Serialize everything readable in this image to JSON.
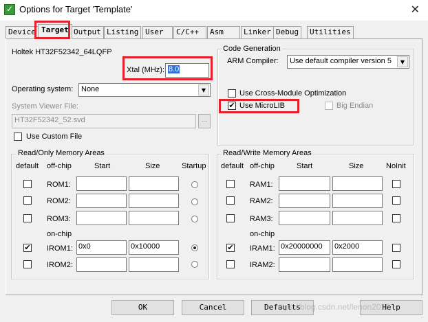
{
  "window": {
    "title": "Options for Target 'Template'",
    "close_glyph": "✕"
  },
  "tabs": [
    {
      "label": "Device",
      "active": false
    },
    {
      "label": "Target",
      "active": true
    },
    {
      "label": "Output",
      "active": false
    },
    {
      "label": "Listing",
      "active": false
    },
    {
      "label": "User",
      "active": false
    },
    {
      "label": "C/C++",
      "active": false
    },
    {
      "label": "Asm",
      "active": false
    },
    {
      "label": "Linker",
      "active": false
    },
    {
      "label": "Debug",
      "active": false
    },
    {
      "label": "Utilities",
      "active": false
    }
  ],
  "target": {
    "device_name": "Holtek HT32F52342_64LQFP",
    "xtal_label": "Xtal (MHz):",
    "xtal_value": "8.0",
    "os_label": "Operating system:",
    "os_value": "None",
    "svf_label": "System Viewer File:",
    "svf_value": "HT32F52342_52.svd",
    "svf_browse": "...",
    "custom_file_label": "Use Custom File"
  },
  "code_gen": {
    "title": "Code Generation",
    "compiler_label": "ARM Compiler:",
    "compiler_value": "Use default compiler version 5",
    "cross_module_label": "Use Cross-Module Optimization",
    "cross_module_checked": false,
    "microlib_label": "Use MicroLIB",
    "microlib_checked": true,
    "big_endian_label": "Big Endian",
    "big_endian_checked": false
  },
  "rom_areas": {
    "title": "Read/Only Memory Areas",
    "headers": {
      "default": "default",
      "offchip": "off-chip",
      "start": "Start",
      "size": "Size",
      "startup": "Startup"
    },
    "onchip_label": "on-chip",
    "rows": [
      {
        "name": "ROM1:",
        "start": "",
        "size": "",
        "default": false,
        "startup": false
      },
      {
        "name": "ROM2:",
        "start": "",
        "size": "",
        "default": false,
        "startup": false
      },
      {
        "name": "ROM3:",
        "start": "",
        "size": "",
        "default": false,
        "startup": false
      },
      {
        "name": "IROM1:",
        "start": "0x0",
        "size": "0x10000",
        "default": true,
        "startup": true
      },
      {
        "name": "IROM2:",
        "start": "",
        "size": "",
        "default": false,
        "startup": false
      }
    ]
  },
  "ram_areas": {
    "title": "Read/Write Memory Areas",
    "headers": {
      "default": "default",
      "offchip": "off-chip",
      "start": "Start",
      "size": "Size",
      "noinit": "NoInit"
    },
    "onchip_label": "on-chip",
    "rows": [
      {
        "name": "RAM1:",
        "start": "",
        "size": "",
        "default": false,
        "noinit": false
      },
      {
        "name": "RAM2:",
        "start": "",
        "size": "",
        "default": false,
        "noinit": false
      },
      {
        "name": "RAM3:",
        "start": "",
        "size": "",
        "default": false,
        "noinit": false
      },
      {
        "name": "IRAM1:",
        "start": "0x20000000",
        "size": "0x2000",
        "default": true,
        "noinit": false
      },
      {
        "name": "IRAM2:",
        "start": "",
        "size": "",
        "default": false,
        "noinit": false
      }
    ]
  },
  "buttons": {
    "ok": "OK",
    "cancel": "Cancel",
    "defaults": "Defaults",
    "help": "Help"
  },
  "watermark": "https://blog.csdn.net/lenon2018",
  "colors": {
    "highlight_red": "#e5202a",
    "selection_blue": "#3070d8"
  }
}
